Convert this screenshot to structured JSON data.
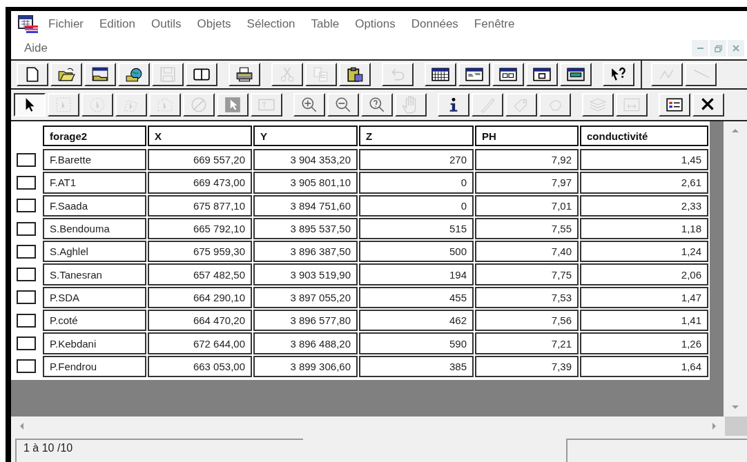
{
  "menu": [
    {
      "label": "Fichier"
    },
    {
      "label": "Edition"
    },
    {
      "label": "Outils"
    },
    {
      "label": "Objets"
    },
    {
      "label": "Sélection"
    },
    {
      "label": "Table"
    },
    {
      "label": "Options"
    },
    {
      "label": "Données"
    },
    {
      "label": "Fenêtre"
    },
    {
      "label": "Aide"
    }
  ],
  "toolbars": [
    [
      {
        "kind": "new",
        "disabled": false
      },
      {
        "kind": "open",
        "disabled": false
      },
      {
        "kind": "workspace",
        "disabled": false
      },
      {
        "kind": "database",
        "disabled": false
      },
      {
        "kind": "save",
        "disabled": true
      },
      {
        "kind": "book",
        "disabled": false
      },
      {
        "kind": "sep"
      },
      {
        "kind": "print",
        "disabled": false
      },
      {
        "kind": "sep"
      },
      {
        "kind": "cut",
        "disabled": true
      },
      {
        "kind": "copy",
        "disabled": true
      },
      {
        "kind": "paste",
        "disabled": false
      },
      {
        "kind": "sep"
      },
      {
        "kind": "undo",
        "disabled": true
      },
      {
        "kind": "sep"
      },
      {
        "kind": "grid",
        "disabled": false
      },
      {
        "kind": "mapwin",
        "disabled": false
      },
      {
        "kind": "layout",
        "disabled": false
      },
      {
        "kind": "graph",
        "disabled": false
      },
      {
        "kind": "redistrict",
        "disabled": false
      },
      {
        "kind": "sep"
      },
      {
        "kind": "help",
        "disabled": false
      },
      {
        "kind": "bigsep"
      },
      {
        "kind": "nodes",
        "disabled": true
      },
      {
        "kind": "line",
        "disabled": true
      }
    ],
    [
      {
        "kind": "arrow",
        "disabled": false,
        "pressed": true
      },
      {
        "kind": "marquee",
        "disabled": true
      },
      {
        "kind": "radius",
        "disabled": true
      },
      {
        "kind": "polygon",
        "disabled": true
      },
      {
        "kind": "boundary",
        "disabled": true
      },
      {
        "kind": "invert",
        "disabled": true
      },
      {
        "kind": "graphic",
        "disabled": false
      },
      {
        "kind": "labelsel",
        "disabled": true
      },
      {
        "kind": "sep"
      },
      {
        "kind": "zoomin",
        "disabled": false
      },
      {
        "kind": "zoomout",
        "disabled": false
      },
      {
        "kind": "query",
        "disabled": false
      },
      {
        "kind": "hand",
        "disabled": true
      },
      {
        "kind": "sep"
      },
      {
        "kind": "info",
        "disabled": false
      },
      {
        "kind": "ruler",
        "disabled": true
      },
      {
        "kind": "tag",
        "disabled": true
      },
      {
        "kind": "drag",
        "disabled": true
      },
      {
        "kind": "sep"
      },
      {
        "kind": "layers",
        "disabled": true
      },
      {
        "kind": "legendnum",
        "disabled": true
      },
      {
        "kind": "sep"
      },
      {
        "kind": "legend",
        "disabled": false
      },
      {
        "kind": "cross",
        "disabled": false
      }
    ]
  ],
  "table": {
    "columns": [
      "forage2",
      "X",
      "Y",
      "Z",
      "PH",
      "conductivité"
    ],
    "rows": [
      {
        "checked": false,
        "cells": [
          "F.Barette",
          "669 557,20",
          "3 904 353,20",
          "270",
          "7,92",
          "1,45"
        ]
      },
      {
        "checked": false,
        "cells": [
          "F.AT1",
          "669 473,00",
          "3 905 801,10",
          "0",
          "7,97",
          "2,61"
        ]
      },
      {
        "checked": false,
        "cells": [
          "F.Saada",
          "675 877,10",
          "3 894 751,60",
          "0",
          "7,01",
          "2,33"
        ]
      },
      {
        "checked": false,
        "cells": [
          "S.Bendouma",
          "665 792,10",
          "3 895 537,50",
          "515",
          "7,55",
          "1,18"
        ]
      },
      {
        "checked": false,
        "cells": [
          "S.Aghlel",
          "675 959,30",
          "3 896 387,50",
          "500",
          "7,40",
          "1,24"
        ]
      },
      {
        "checked": false,
        "cells": [
          "S.Tanesran",
          "657 482,50",
          "3 903 519,90",
          "194",
          "7,75",
          "2,06"
        ]
      },
      {
        "checked": false,
        "cells": [
          "P.SDA",
          "664 290,10",
          "3 897 055,20",
          "455",
          "7,53",
          "1,47"
        ]
      },
      {
        "checked": false,
        "cells": [
          "P.coté",
          "664 470,20",
          "3 896 577,80",
          "462",
          "7,56",
          "1,41"
        ]
      },
      {
        "checked": false,
        "cells": [
          "P.Kebdani",
          "672 644,00",
          "3 896 488,20",
          "590",
          "7,21",
          "1,26"
        ]
      },
      {
        "checked": false,
        "cells": [
          "P.Fendrou",
          "663 053,00",
          "3 899 306,60",
          "385",
          "7,39",
          "1,64"
        ]
      }
    ]
  },
  "status_bar": {
    "record_count": "1 à 10 /10"
  }
}
